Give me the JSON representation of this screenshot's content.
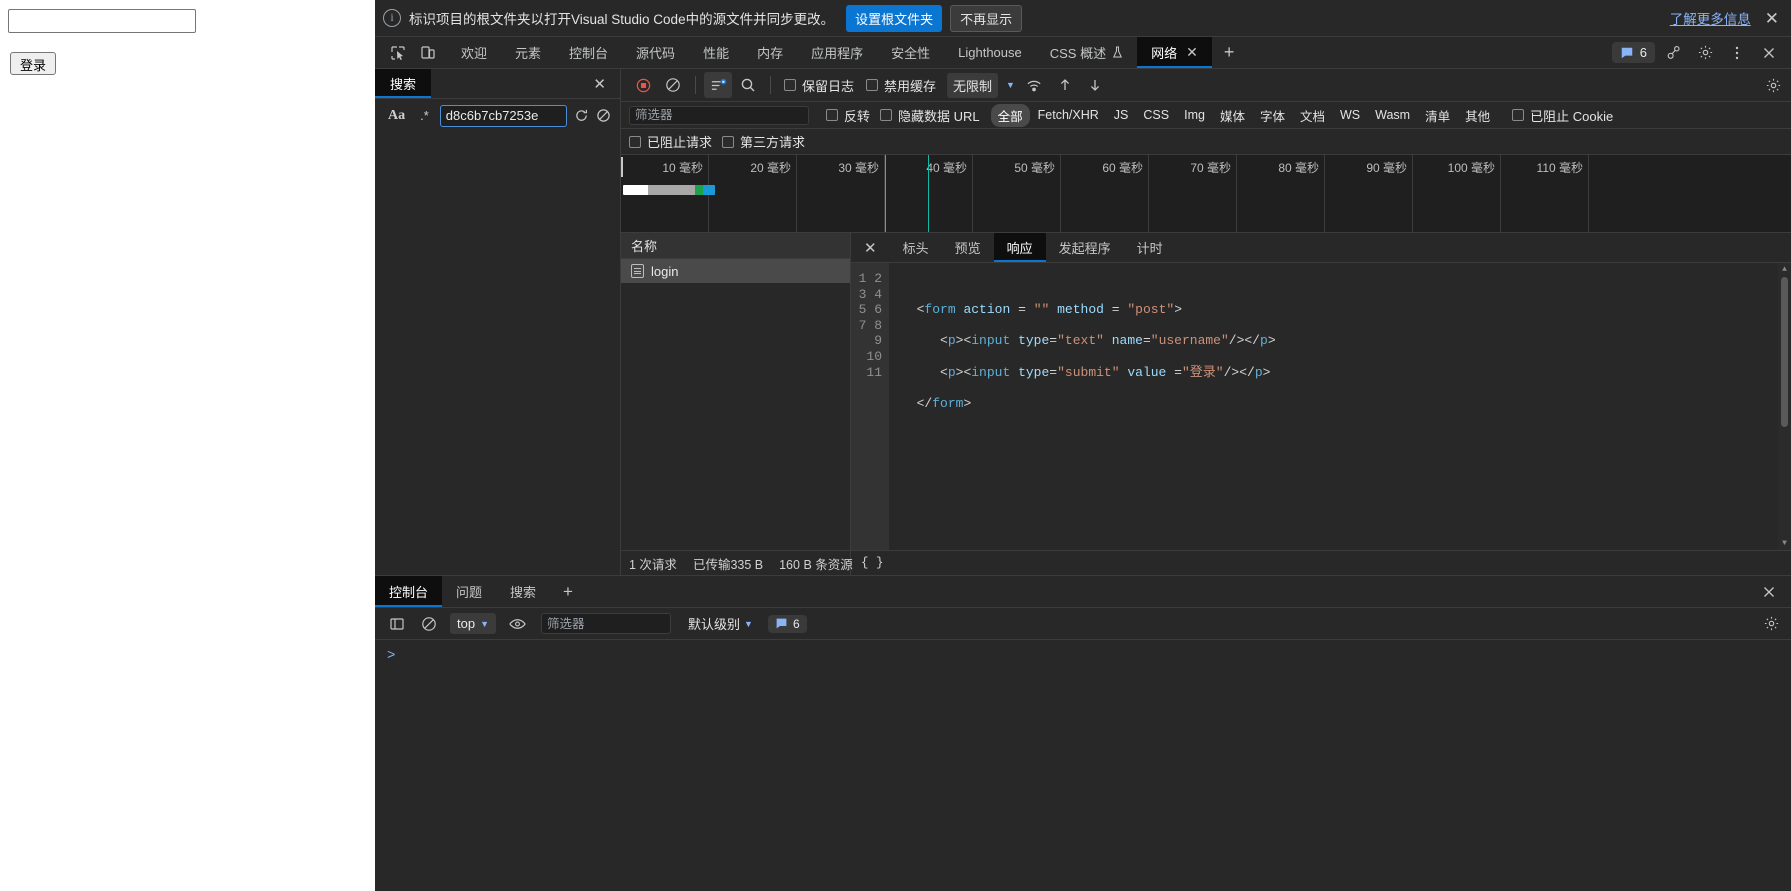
{
  "page": {
    "input_value": "",
    "input_placeholder": "",
    "submit_label": "登录"
  },
  "infobar": {
    "icon": "info-icon",
    "message": "标识项目的根文件夹以打开Visual Studio Code中的源文件并同步更改。",
    "primary_button": "设置根文件夹",
    "secondary_button": "不再显示",
    "learn_more": "了解更多信息",
    "close": "✕"
  },
  "tabstrip": {
    "inspect_icon": "inspect-element-icon",
    "device_icon": "device-toolbar-icon",
    "tabs": [
      {
        "label": "欢迎",
        "selected": false
      },
      {
        "label": "元素",
        "selected": false
      },
      {
        "label": "控制台",
        "selected": false
      },
      {
        "label": "源代码",
        "selected": false
      },
      {
        "label": "性能",
        "selected": false
      },
      {
        "label": "内存",
        "selected": false
      },
      {
        "label": "应用程序",
        "selected": false
      },
      {
        "label": "安全性",
        "selected": false
      },
      {
        "label": "Lighthouse",
        "selected": false
      },
      {
        "label": "CSS 概述",
        "selected": false
      },
      {
        "label": "网络",
        "selected": true
      }
    ],
    "add_tab": "+",
    "issues_count": "6",
    "settings_icon": "gear-icon",
    "more_icon": "more-vertical-icon",
    "close_icon": "close-icon"
  },
  "sidebar": {
    "tab_label": "搜索",
    "close": "✕",
    "match_case": "Aa",
    "regex": ".*",
    "query": "d8c6b7cb7253e",
    "refresh_icon": "refresh-icon",
    "clear_icon": "clear-icon"
  },
  "network": {
    "toolbar": {
      "record_icon": "record-stop-icon",
      "clear_icon": "clear-icon",
      "filter_icon": "filter-icon",
      "search_icon": "search-icon",
      "preserve_log": "保留日志",
      "disable_cache": "禁用缓存",
      "throttle_value": "无限制",
      "import_icon": "import-har-icon",
      "export_icon": "export-har-icon",
      "wifi_icon": "network-conditions-icon",
      "settings_icon": "gear-icon"
    },
    "filterbar": {
      "filter_placeholder": "筛选器",
      "invert": "反转",
      "hide_data_urls": "隐藏数据 URL",
      "types": [
        "全部",
        "Fetch/XHR",
        "JS",
        "CSS",
        "Img",
        "媒体",
        "字体",
        "文档",
        "WS",
        "Wasm",
        "清单",
        "其他"
      ],
      "selected_type": "全部",
      "blocked_cookies": "已阻止 Cookie"
    },
    "blockedbar": {
      "blocked_requests": "已阻止请求",
      "third_party": "第三方请求"
    },
    "timeline": {
      "ticks": [
        "10 毫秒",
        "20 毫秒",
        "30 毫秒",
        "40 毫秒",
        "50 毫秒",
        "60 毫秒",
        "70 毫秒",
        "80 毫秒",
        "90 毫秒",
        "100 毫秒",
        "110 毫秒"
      ]
    },
    "list": {
      "header": "名称",
      "rows": [
        {
          "name": "login",
          "icon": "document-icon",
          "selected": true
        }
      ]
    },
    "detail": {
      "close": "✕",
      "tabs": [
        {
          "label": "标头",
          "selected": false
        },
        {
          "label": "预览",
          "selected": false
        },
        {
          "label": "响应",
          "selected": true
        },
        {
          "label": "发起程序",
          "selected": false
        },
        {
          "label": "计时",
          "selected": false
        }
      ],
      "line_numbers": [
        "1",
        "2",
        "3",
        "4",
        "5",
        "6",
        "7",
        "8",
        "9",
        "10",
        "11"
      ],
      "code_lines": [
        "",
        "",
        "  <form action = \"\" method = \"post\">",
        "",
        "     <p><input type=\"text\" name=\"username\"/></p>",
        "",
        "     <p><input type=\"submit\" value =\"登录\"/></p>",
        "",
        "  </form>",
        "",
        ""
      ]
    },
    "status": {
      "requests": "1 次请求",
      "transferred": "已传输335 B",
      "resources": "160 B 条资源",
      "json_icon": "{ }"
    }
  },
  "drawer": {
    "tabs": [
      {
        "label": "控制台",
        "selected": true
      },
      {
        "label": "问题",
        "selected": false
      },
      {
        "label": "搜索",
        "selected": false
      }
    ],
    "add_tab": "+",
    "close": "✕",
    "toolbar": {
      "sidebar_icon": "console-sidebar-icon",
      "clear_icon": "clear-console-icon",
      "context": "top",
      "eye_icon": "live-expression-icon",
      "filter_placeholder": "筛选器",
      "levels": "默认级别",
      "issues_count": "6",
      "settings_icon": "gear-icon"
    },
    "prompt": ">"
  },
  "colors": {
    "accent": "#0b76d1",
    "link": "#8ab4f8",
    "record": "#e8564a",
    "bg": "#282828",
    "bg_dark": "#1f1f1f",
    "tab_selected_bg": "#0e0e0e"
  }
}
